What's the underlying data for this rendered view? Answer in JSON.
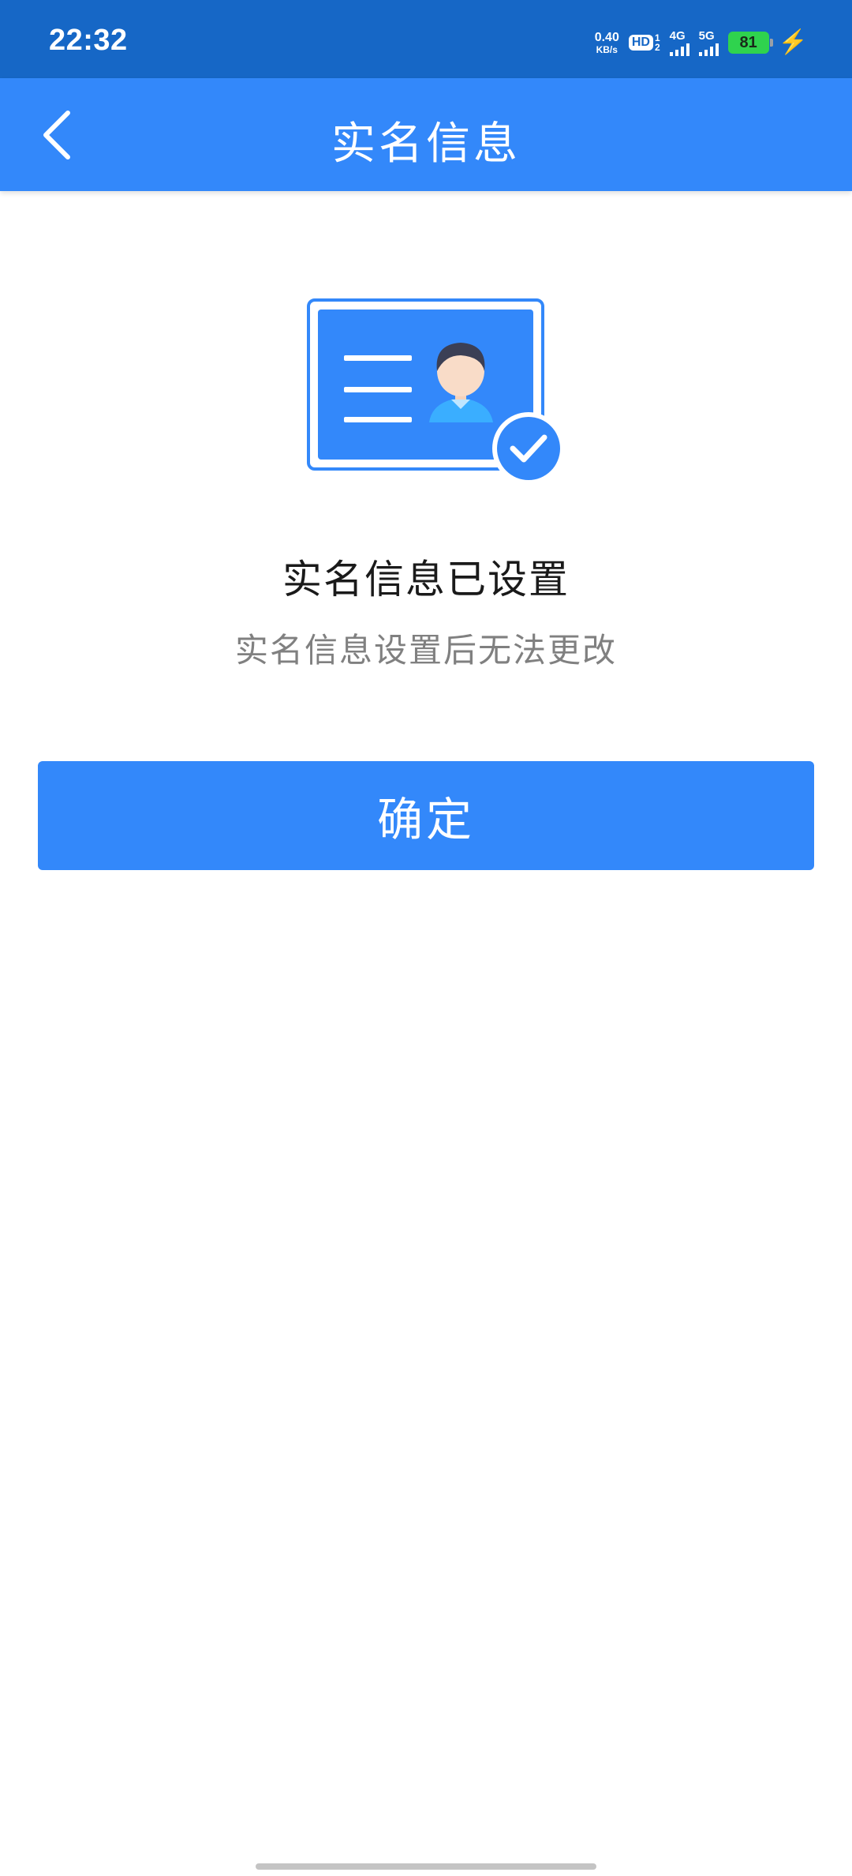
{
  "status_bar": {
    "time": "22:32",
    "net_speed_value": "0.40",
    "net_speed_unit": "KB/s",
    "hd_label": "HD",
    "hd_sim_top": "1",
    "hd_sim_bottom": "2",
    "signal_1_label": "4G",
    "signal_2_label": "5G",
    "battery_level": "81",
    "icons": [
      "network-speed",
      "hd-voice-icon",
      "signal-4g-icon",
      "signal-5g-icon",
      "battery-icon",
      "charging-bolt-icon"
    ]
  },
  "header": {
    "title": "实名信息",
    "back_icon": "chevron-left-icon"
  },
  "main": {
    "illustration_icon": "id-card-verified-icon",
    "heading": "实名信息已设置",
    "subtext": "实名信息设置后无法更改",
    "confirm_label": "确定"
  },
  "colors": {
    "status_bar": "#1667c6",
    "primary": "#3388fa",
    "heading_text": "#1a1a1a",
    "sub_text": "#808080",
    "battery": "#2fd34e"
  }
}
